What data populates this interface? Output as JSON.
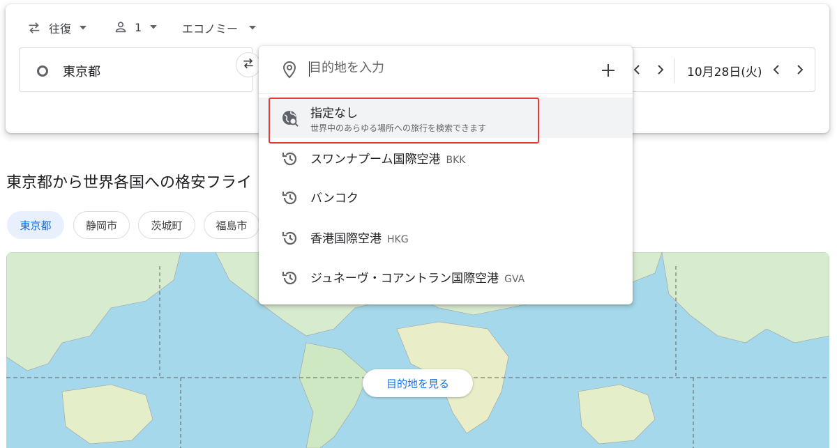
{
  "trip_options": {
    "trip_type": "往復",
    "passengers": "1",
    "cabin_class": "エコノミー"
  },
  "origin": {
    "value": "東京都"
  },
  "dates": {
    "return_date": "10月28日(火)"
  },
  "destination_dropdown": {
    "placeholder": "目的地を入力",
    "anywhere": {
      "title": "指定なし",
      "subtitle": "世界中のあらゆる場所への旅行を検索できます"
    },
    "recent": [
      {
        "name": "スワンナプーム国際空港",
        "code": "BKK"
      },
      {
        "name": "バンコク",
        "code": ""
      },
      {
        "name": "香港国際空港",
        "code": "HKG"
      },
      {
        "name": "ジュネーヴ・コアントラン国際空港",
        "code": "GVA"
      }
    ]
  },
  "explore": {
    "heading": "東京都から世界各国への格安フライ",
    "chips": [
      "東京都",
      "静岡市",
      "茨城町",
      "福島市"
    ],
    "map_button": "目的地を見る"
  },
  "colors": {
    "accent": "#1a73e8",
    "highlight_border": "#e53935",
    "ocean": "#a4d8ea",
    "land": "#d7ebcf"
  }
}
